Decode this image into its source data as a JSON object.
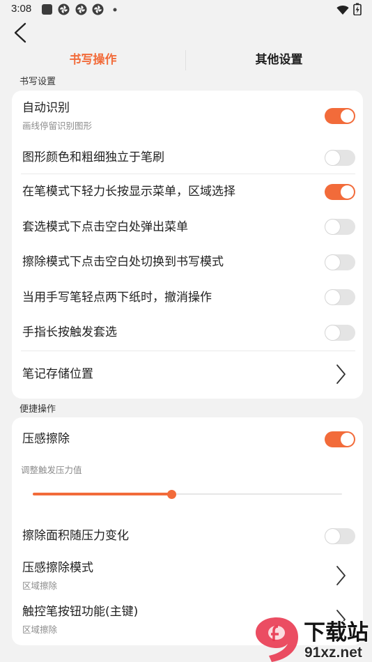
{
  "colors": {
    "accent": "#f26b3a",
    "background": "#f2f2f2",
    "card": "#ffffff",
    "text": "#1f1f1f",
    "subtext": "#8c8c8c",
    "divider": "#e9e9e9",
    "toggle_off": "#e4e4e4"
  },
  "status_bar": {
    "time": "3:08",
    "left_icons": [
      "square-notification-icon",
      "pinwheel-icon",
      "pinwheel-icon",
      "pinwheel-icon",
      "dot-icon"
    ],
    "right_icons": [
      "wifi-icon",
      "battery-charging-icon"
    ]
  },
  "header": {
    "back_icon": "chevron-left-icon"
  },
  "tabs": [
    {
      "label": "书写操作",
      "active": true
    },
    {
      "label": "其他设置",
      "active": false
    }
  ],
  "writing_settings": {
    "section_title": "书写设置",
    "items": [
      {
        "title": "自动识别",
        "subtitle": "画线停留识别图形",
        "toggle_on": true
      },
      {
        "title": "图形颜色和粗细独立于笔刷",
        "toggle_on": false
      },
      {
        "title": "在笔模式下轻力长按显示菜单，区域选择",
        "toggle_on": true
      },
      {
        "title": "套选模式下点击空白处弹出菜单",
        "toggle_on": false
      },
      {
        "title": "擦除模式下点击空白处切换到书写模式",
        "toggle_on": false
      },
      {
        "title": "当用手写笔轻点两下纸时，撤消操作",
        "toggle_on": false
      },
      {
        "title": "手指长按触发套选",
        "toggle_on": false
      },
      {
        "title": "笔记存储位置",
        "chevron_icon": "chevron-right-icon"
      }
    ]
  },
  "quick_actions": {
    "section_title": "便捷操作",
    "items": [
      {
        "title": "压感擦除",
        "toggle_on": true
      },
      {
        "label": "调整触发压力值",
        "slider_value_percent": 45
      },
      {
        "title": "擦除面积随压力变化",
        "toggle_on": false
      },
      {
        "title": "压感擦除模式",
        "subtitle": "区域擦除",
        "chevron_icon": "chevron-right-icon"
      },
      {
        "title": "触控笔按钮功能(主键)",
        "subtitle": "区域擦除",
        "chevron_icon": "chevron-right-icon"
      }
    ]
  },
  "watermark": {
    "logo_icon": "91-logo-icon",
    "brand": "下载站",
    "domain": "91xz.net"
  }
}
